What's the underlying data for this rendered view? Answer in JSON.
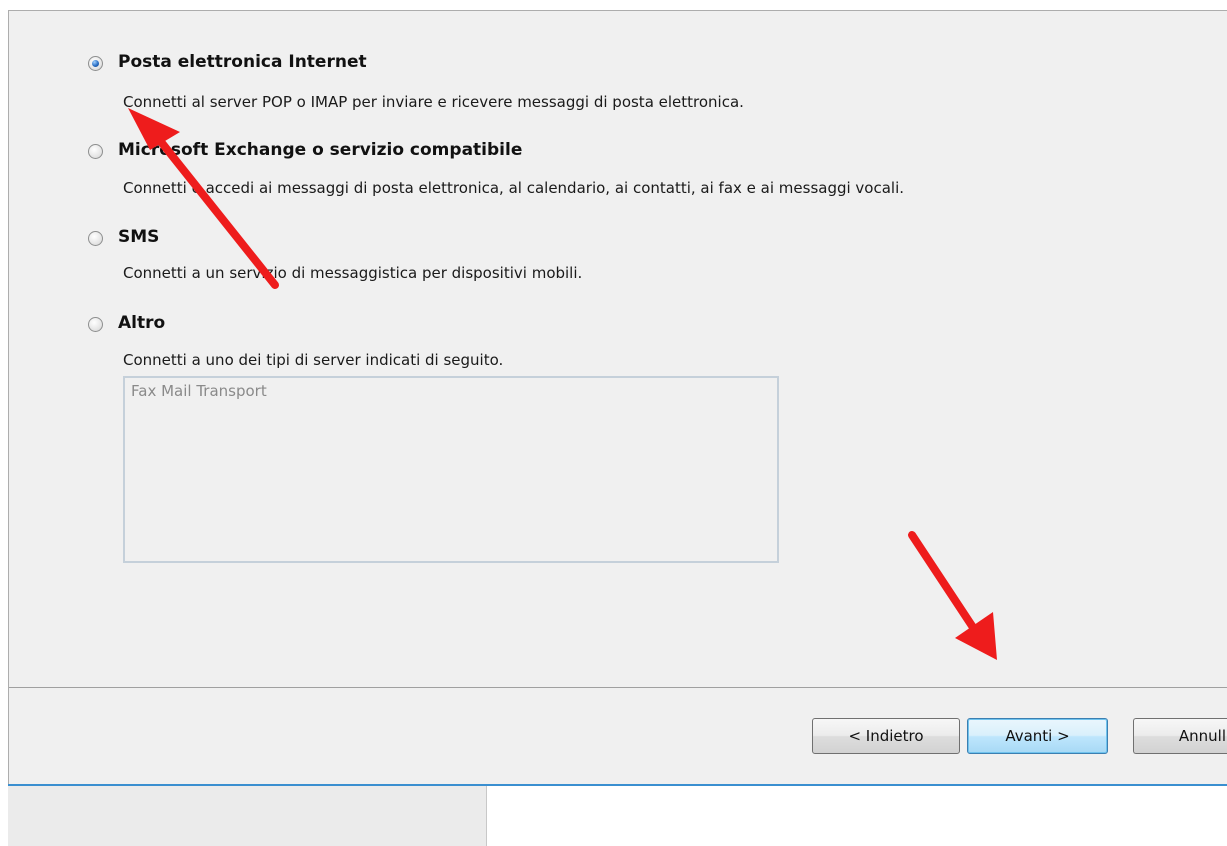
{
  "options": [
    {
      "label": "Posta elettronica Internet",
      "description": "Connetti al server POP o IMAP per inviare e ricevere messaggi di posta elettronica.",
      "selected": true
    },
    {
      "label": "Microsoft Exchange o servizio compatibile",
      "description": "Connetti e accedi ai messaggi di posta elettronica, al calendario, ai contatti, ai fax e ai messaggi vocali.",
      "selected": false
    },
    {
      "label": "SMS",
      "description": "Connetti a un servizio di messaggistica per dispositivi mobili.",
      "selected": false
    },
    {
      "label": "Altro",
      "description": "Connetti a uno dei tipi di server indicati di seguito.",
      "selected": false
    }
  ],
  "server_list": {
    "items": [
      "Fax Mail Transport"
    ]
  },
  "buttons": {
    "back": "< Indietro",
    "next": "Avanti >",
    "cancel": "Annull"
  },
  "annotations": {
    "arrow_color": "#ee1c1c"
  }
}
